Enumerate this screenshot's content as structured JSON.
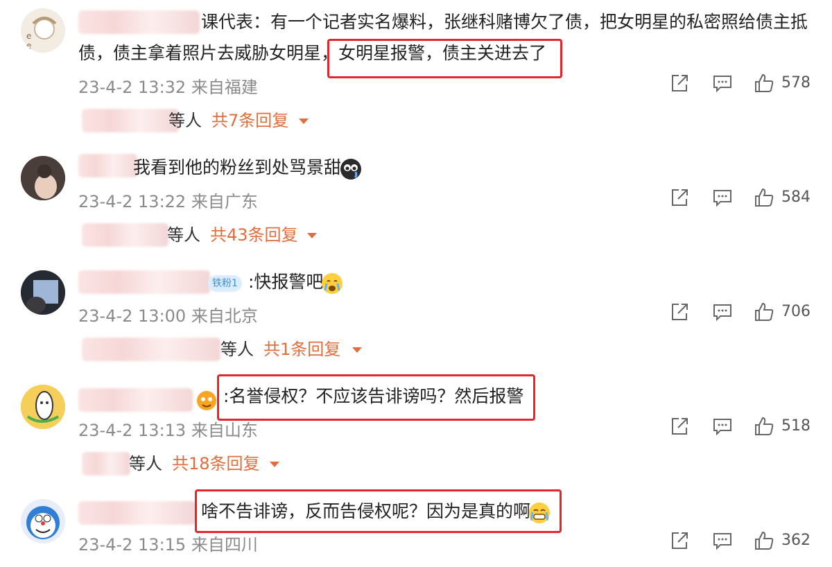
{
  "comments": [
    {
      "text_line1": "课代表：有一个记者实名爆料，张继科赌博欠了债，把女明星的私密照给债主抵",
      "text_line2_prefix": "债，债主拿着照片去威胁女明星，",
      "text_line2_highlight": "女明星报警，债主关进去了",
      "time": "23-4-2 13:32",
      "location": "来自福建",
      "likes": "578",
      "replies_who": "等人",
      "replies_count": "共7条回复"
    },
    {
      "text": "我看到他的粉丝到处骂景甜",
      "time": "23-4-2 13:22",
      "location": "来自广东",
      "likes": "584",
      "replies_who": "等人",
      "replies_count": "共43条回复"
    },
    {
      "badge": "铁粉1",
      "text": ":快报警吧",
      "time": "23-4-2 13:00",
      "location": "来自北京",
      "likes": "706",
      "replies_who": "等人",
      "replies_count": "共1条回复"
    },
    {
      "text": ":名誉侵权？不应该告诽谤吗？然后报警",
      "time": "23-4-2 13:13",
      "location": "来自山东",
      "likes": "518",
      "replies_who": "等人",
      "replies_count": "共18条回复"
    },
    {
      "text": "啥不告诽谤，反而告侵权呢？因为是真的啊",
      "time": "23-4-2 13:15",
      "location": "来自四川",
      "likes": "362"
    }
  ],
  "colors": {
    "highlight_box": "#e3262b",
    "reply_count": "#e06d3c",
    "meta_text": "#8a8a8a"
  },
  "icons": [
    "share-icon",
    "comment-icon",
    "like-icon",
    "caret-down-icon"
  ]
}
